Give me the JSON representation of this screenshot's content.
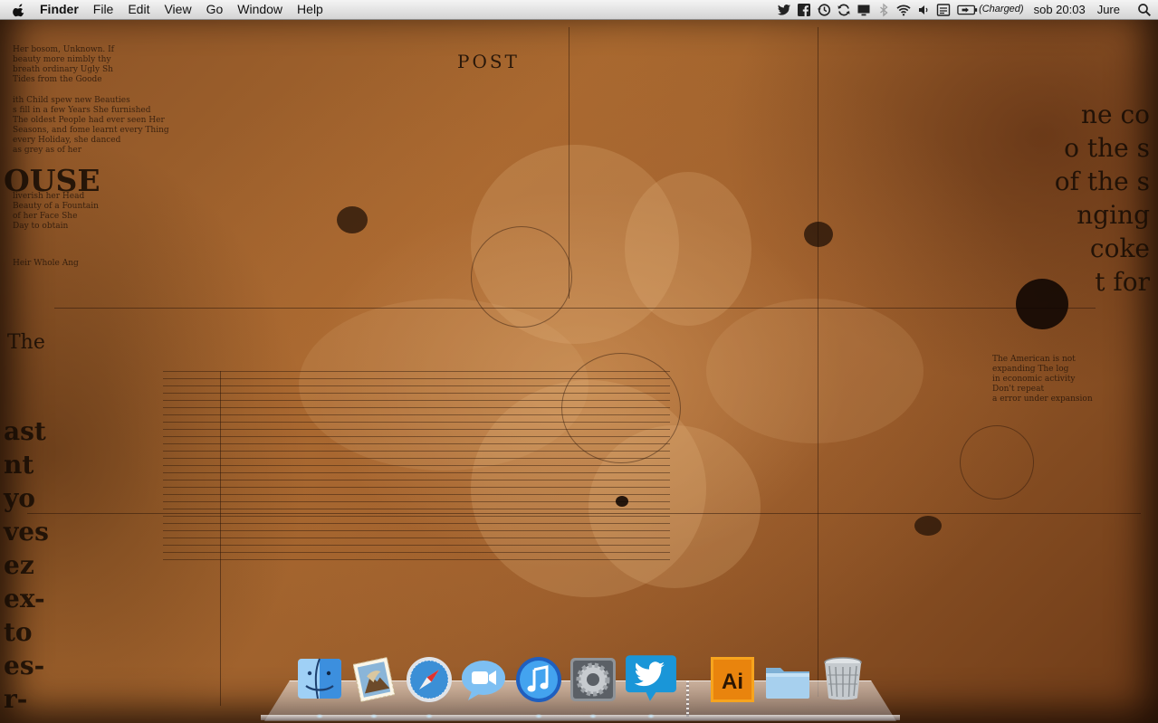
{
  "menubar": {
    "app_name": "Finder",
    "menus": [
      "File",
      "Edit",
      "View",
      "Go",
      "Window",
      "Help"
    ],
    "status": {
      "icons": [
        "twitter-icon",
        "facebook-icon",
        "time-machine-icon",
        "sync-icon",
        "display-icon",
        "bluetooth-icon",
        "wifi-icon",
        "volume-icon",
        "input-menu-icon",
        "battery-icon"
      ],
      "battery_text": "(Charged)",
      "clock": "sob 20:03",
      "user": "Jure",
      "search_icon": "spotlight-icon"
    }
  },
  "wallpaper": {
    "left_big": "OUSE",
    "left_the": "The",
    "left_column": [
      "ast",
      "nt",
      "yo",
      "ves",
      "ez",
      "ex-",
      "to",
      "es-",
      "r-"
    ],
    "right_lines": [
      "ne co",
      "o the s",
      "of the s",
      "nging",
      "coke",
      "t for"
    ],
    "post": "POST",
    "left_small": [
      "Her bosom, Unknown. If",
      "beauty more nimbly thy",
      "breath ordinary Ugly Sh",
      "Tides from the Goode",
      "ith Child spew new Beauties",
      "s fill in a few Years She furnished",
      "The oldest People had ever seen Her",
      "Seasons, and fome learnt every Thing",
      "every Holiday, she danced",
      "as grey as of her",
      "liverish her Head",
      "Beauty of a Fountain",
      "of her Face She",
      "Day to obtain",
      "Heir Whole Ang"
    ],
    "right_small": [
      "The American is not",
      "expanding The log",
      "in economic activity",
      "Don't repeat",
      "a error under expansion"
    ]
  },
  "dock": {
    "items": [
      {
        "name": "Finder",
        "icon": "finder-icon",
        "running": true
      },
      {
        "name": "Mail",
        "icon": "mail-icon",
        "running": true
      },
      {
        "name": "Safari",
        "icon": "safari-icon",
        "running": true
      },
      {
        "name": "FaceTime",
        "icon": "facetime-icon",
        "running": false
      },
      {
        "name": "iTunes",
        "icon": "itunes-icon",
        "running": true
      },
      {
        "name": "System Preferences",
        "icon": "system-preferences-icon",
        "running": true
      },
      {
        "name": "Twitter",
        "icon": "twitter-app-icon",
        "running": true
      },
      {
        "name": "Adobe Illustrator",
        "icon": "illustrator-icon",
        "running": false,
        "label": "Ai"
      },
      {
        "name": "Documents",
        "icon": "folder-icon",
        "running": false
      },
      {
        "name": "Trash",
        "icon": "trash-icon",
        "running": false
      }
    ]
  }
}
